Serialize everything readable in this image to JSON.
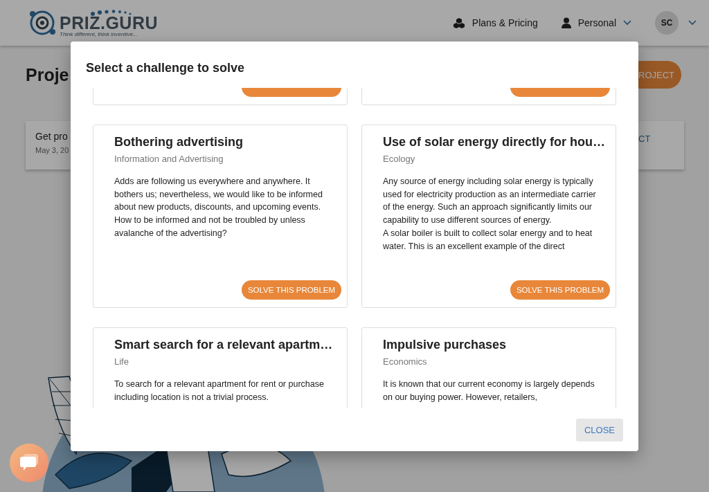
{
  "header": {
    "logo_text": "PRIZ.GURU",
    "tagline": "Think different, think inventive...",
    "nav": [
      {
        "kind": "plans",
        "label": "Plans & Pricing"
      },
      {
        "kind": "account",
        "label": "Personal"
      }
    ],
    "avatar": "SC"
  },
  "page": {
    "title": "Proje",
    "new_button": "ROJECT",
    "project_card": {
      "name": "Get pro",
      "date": "May 3, 20",
      "link": "CT"
    }
  },
  "dialog": {
    "title": "Select a challenge to solve",
    "challenges": [
      {
        "kind": "tail"
      },
      {
        "kind": "tail"
      },
      {
        "kind": "full",
        "title": "Bothering advertising",
        "category": "Information and Advertising",
        "description": " Adds are following us everywhere and anywhere. It bothers us; nevertheless, we would like to be informed about new products, discounts, and upcoming events. How to be informed and not be troubled by unless avalanche of the advertising?",
        "button": "SOLVE THIS PROBLEM"
      },
      {
        "kind": "full",
        "title": "Use of solar energy directly for hou…",
        "category": "Ecology",
        "description": " Any source of energy including solar energy is typically used for electricity production as an intermediate carrier of the energy. Such an approach significantly limits our capability to use different sources of energy.\nA solar boiler is built to collect solar energy and to heat water. This is an excellent example of the direct",
        "button": "SOLVE THIS PROBLEM"
      },
      {
        "kind": "head",
        "title": "Smart search for a relevant apartm…",
        "category": "Life",
        "description": " To search for a relevant apartment for rent or purchase including location is not a trivial process."
      },
      {
        "kind": "head",
        "title": "Impulsive purchases",
        "category": "Economics",
        "description": " It is known that our current economy is largely depends on our buying power. However, retailers,"
      }
    ],
    "close_button": "CLOSE"
  }
}
